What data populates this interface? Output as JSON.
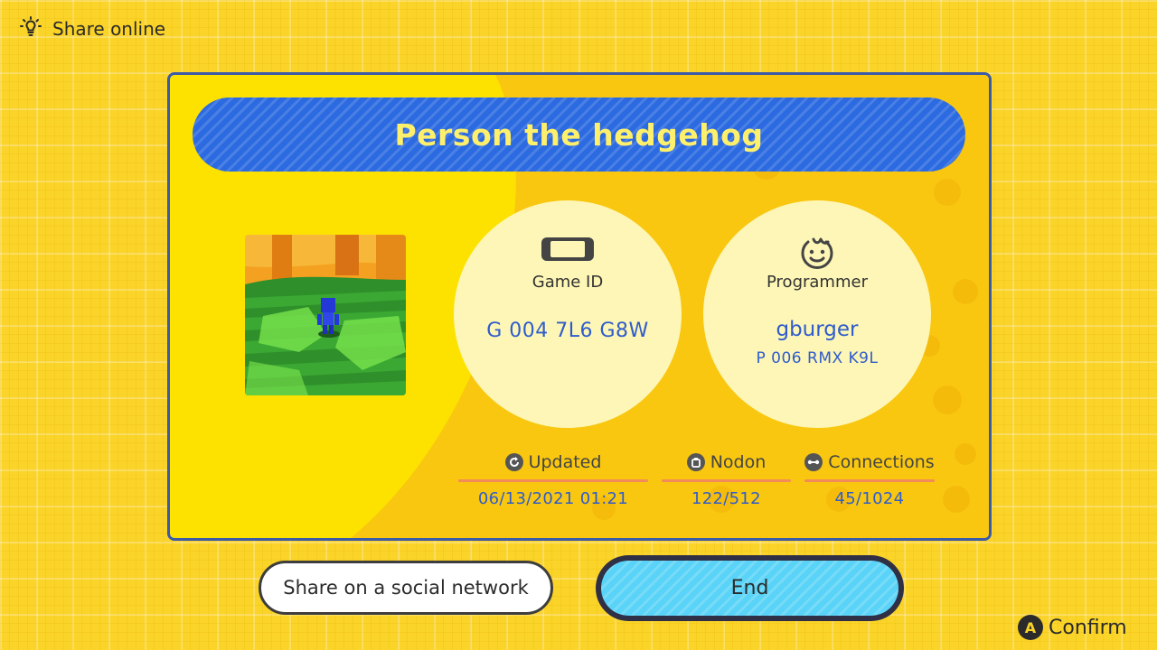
{
  "header": {
    "title": "Share online",
    "icon": "lightbulb-icon"
  },
  "game": {
    "title": "Person the hedgehog",
    "game_id_label": "Game ID",
    "game_id": "G 004 7L6 G8W",
    "programmer_label": "Programmer",
    "programmer_name": "gburger",
    "programmer_id": "P 006 RMX K9L"
  },
  "stats": {
    "updated_label": "Updated",
    "updated_value": "06/13/2021 01:21",
    "nodon_label": "Nodon",
    "nodon_value": "122/512",
    "connections_label": "Connections",
    "connections_value": "45/1024"
  },
  "buttons": {
    "share": "Share on a social network",
    "end": "End"
  },
  "footer": {
    "confirm_key": "A",
    "confirm_label": "Confirm"
  },
  "colors": {
    "background": "#fbd429",
    "title_bar": "#2b6ae0",
    "title_text": "#fff06b",
    "value_text": "#2f5ccc",
    "end_button": "#59d3f7"
  }
}
